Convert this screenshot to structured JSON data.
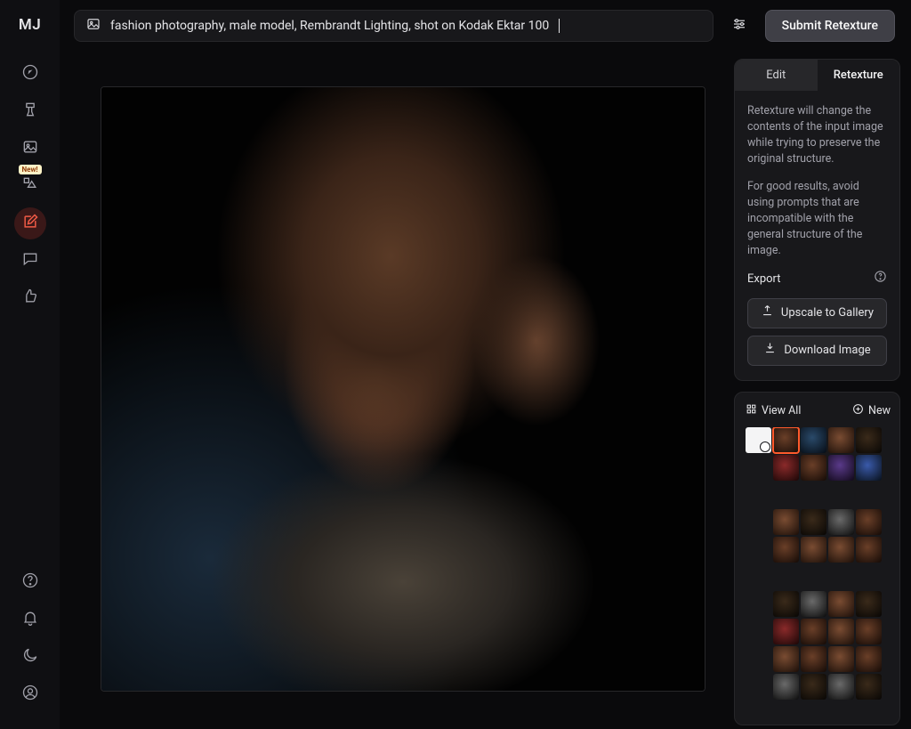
{
  "logo": "MJ",
  "prompt": {
    "text": "fashion photography, male model, Rembrandt Lighting, shot on Kodak Ektar 100"
  },
  "submit_label": "Submit Retexture",
  "nav": {
    "new_badge": "New!"
  },
  "tabs": {
    "edit": "Edit",
    "retexture": "Retexture"
  },
  "info": {
    "p1": "Retexture will change the contents of the input image while trying to preserve the original structure.",
    "p2": "For good results, avoid using prompts that are incompatible with the general structure of the image."
  },
  "export": {
    "title": "Export",
    "upscale": "Upscale to Gallery",
    "download": "Download Image"
  },
  "gallery": {
    "view_all": "View All",
    "new": "New"
  }
}
